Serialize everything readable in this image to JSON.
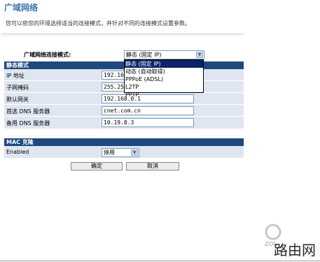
{
  "page": {
    "title": "广域网络",
    "description": "您可以依您的环境选择适当的连接模式，并针对不同的连接模式设置参数。"
  },
  "wan_mode": {
    "label": "广域网络连接模式:",
    "selected": "静态 (固定 IP)",
    "options": [
      "静态 (固定 IP)",
      "动态 (自动取得)",
      "PPPoE (ADSL)",
      "L2TP",
      "PPTP"
    ]
  },
  "static_section": {
    "header": "静态模式",
    "fields": [
      {
        "label": "IP 地址",
        "value": "192.168.0.1"
      },
      {
        "label": "子网掩码",
        "value": "255.255.255.0"
      },
      {
        "label": "默认网关",
        "value": "192.168.0.1"
      },
      {
        "label": "首选 DNS 服务器",
        "value": "cnet.com.cn"
      },
      {
        "label": "备用 DNS 服务器",
        "value": "10.19.8.3"
      }
    ]
  },
  "mac_section": {
    "header": "MAC 克隆",
    "label": "Enabled",
    "selected": "停用"
  },
  "buttons": {
    "ok": "确定",
    "cancel": "取消"
  },
  "watermark": {
    "text": "路由网",
    "logo_text": "中关村在线 ZOL"
  }
}
